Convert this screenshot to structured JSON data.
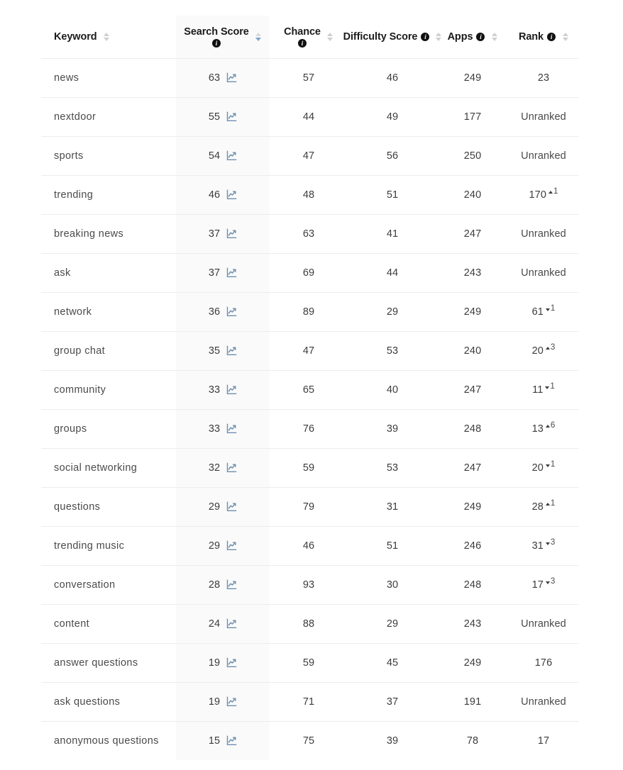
{
  "table": {
    "columns": [
      {
        "key": "keyword",
        "label": "Keyword",
        "has_info": false,
        "sort": "none",
        "align": "left",
        "shaded": false,
        "stacked": false
      },
      {
        "key": "search_score",
        "label": "Search Score",
        "has_info": true,
        "sort": "desc",
        "align": "center",
        "shaded": true,
        "stacked": true
      },
      {
        "key": "chance",
        "label": "Chance",
        "has_info": true,
        "sort": "none",
        "align": "center",
        "shaded": false,
        "stacked": true
      },
      {
        "key": "difficulty",
        "label": "Difficulty Score",
        "has_info": true,
        "sort": "none",
        "align": "center",
        "shaded": false,
        "stacked": false
      },
      {
        "key": "apps",
        "label": "Apps",
        "has_info": true,
        "sort": "none",
        "align": "center",
        "shaded": false,
        "stacked": false
      },
      {
        "key": "rank",
        "label": "Rank",
        "has_info": true,
        "sort": "none",
        "align": "center",
        "shaded": false,
        "stacked": false
      }
    ],
    "unranked_label": "Unranked",
    "info_glyph": "i",
    "chart_icon_name": "line-chart-icon",
    "rows": [
      {
        "keyword": "news",
        "search_score": 63,
        "chance": 57,
        "difficulty": 46,
        "apps": 249,
        "rank": "23",
        "rank_delta": null,
        "rank_dir": null
      },
      {
        "keyword": "nextdoor",
        "search_score": 55,
        "chance": 44,
        "difficulty": 49,
        "apps": 177,
        "rank": "Unranked",
        "rank_delta": null,
        "rank_dir": null
      },
      {
        "keyword": "sports",
        "search_score": 54,
        "chance": 47,
        "difficulty": 56,
        "apps": 250,
        "rank": "Unranked",
        "rank_delta": null,
        "rank_dir": null
      },
      {
        "keyword": "trending",
        "search_score": 46,
        "chance": 48,
        "difficulty": 51,
        "apps": 240,
        "rank": "170",
        "rank_delta": 1,
        "rank_dir": "up"
      },
      {
        "keyword": "breaking news",
        "search_score": 37,
        "chance": 63,
        "difficulty": 41,
        "apps": 247,
        "rank": "Unranked",
        "rank_delta": null,
        "rank_dir": null
      },
      {
        "keyword": "ask",
        "search_score": 37,
        "chance": 69,
        "difficulty": 44,
        "apps": 243,
        "rank": "Unranked",
        "rank_delta": null,
        "rank_dir": null
      },
      {
        "keyword": "network",
        "search_score": 36,
        "chance": 89,
        "difficulty": 29,
        "apps": 249,
        "rank": "61",
        "rank_delta": 1,
        "rank_dir": "down"
      },
      {
        "keyword": "group chat",
        "search_score": 35,
        "chance": 47,
        "difficulty": 53,
        "apps": 240,
        "rank": "20",
        "rank_delta": 3,
        "rank_dir": "up"
      },
      {
        "keyword": "community",
        "search_score": 33,
        "chance": 65,
        "difficulty": 40,
        "apps": 247,
        "rank": "11",
        "rank_delta": 1,
        "rank_dir": "down"
      },
      {
        "keyword": "groups",
        "search_score": 33,
        "chance": 76,
        "difficulty": 39,
        "apps": 248,
        "rank": "13",
        "rank_delta": 6,
        "rank_dir": "up"
      },
      {
        "keyword": "social networking",
        "search_score": 32,
        "chance": 59,
        "difficulty": 53,
        "apps": 247,
        "rank": "20",
        "rank_delta": 1,
        "rank_dir": "down"
      },
      {
        "keyword": "questions",
        "search_score": 29,
        "chance": 79,
        "difficulty": 31,
        "apps": 249,
        "rank": "28",
        "rank_delta": 1,
        "rank_dir": "up"
      },
      {
        "keyword": "trending music",
        "search_score": 29,
        "chance": 46,
        "difficulty": 51,
        "apps": 246,
        "rank": "31",
        "rank_delta": 3,
        "rank_dir": "down"
      },
      {
        "keyword": "conversation",
        "search_score": 28,
        "chance": 93,
        "difficulty": 30,
        "apps": 248,
        "rank": "17",
        "rank_delta": 3,
        "rank_dir": "down"
      },
      {
        "keyword": "content",
        "search_score": 24,
        "chance": 88,
        "difficulty": 29,
        "apps": 243,
        "rank": "Unranked",
        "rank_delta": null,
        "rank_dir": null
      },
      {
        "keyword": "answer questions",
        "search_score": 19,
        "chance": 59,
        "difficulty": 45,
        "apps": 249,
        "rank": "176",
        "rank_delta": null,
        "rank_dir": null
      },
      {
        "keyword": "ask questions",
        "search_score": 19,
        "chance": 71,
        "difficulty": 37,
        "apps": 191,
        "rank": "Unranked",
        "rank_delta": null,
        "rank_dir": null
      },
      {
        "keyword": "anonymous questions",
        "search_score": 15,
        "chance": 75,
        "difficulty": 39,
        "apps": 78,
        "rank": "17",
        "rank_delta": null,
        "rank_dir": null
      }
    ]
  },
  "colors": {
    "chart_icon": "#6d8fae",
    "sort_active": "#7ba7cc",
    "sort_inactive": "#cfcfcf",
    "header_shaded_bg": "#fafafa",
    "row_divider": "#ededed",
    "text": "#3c3c3c"
  }
}
